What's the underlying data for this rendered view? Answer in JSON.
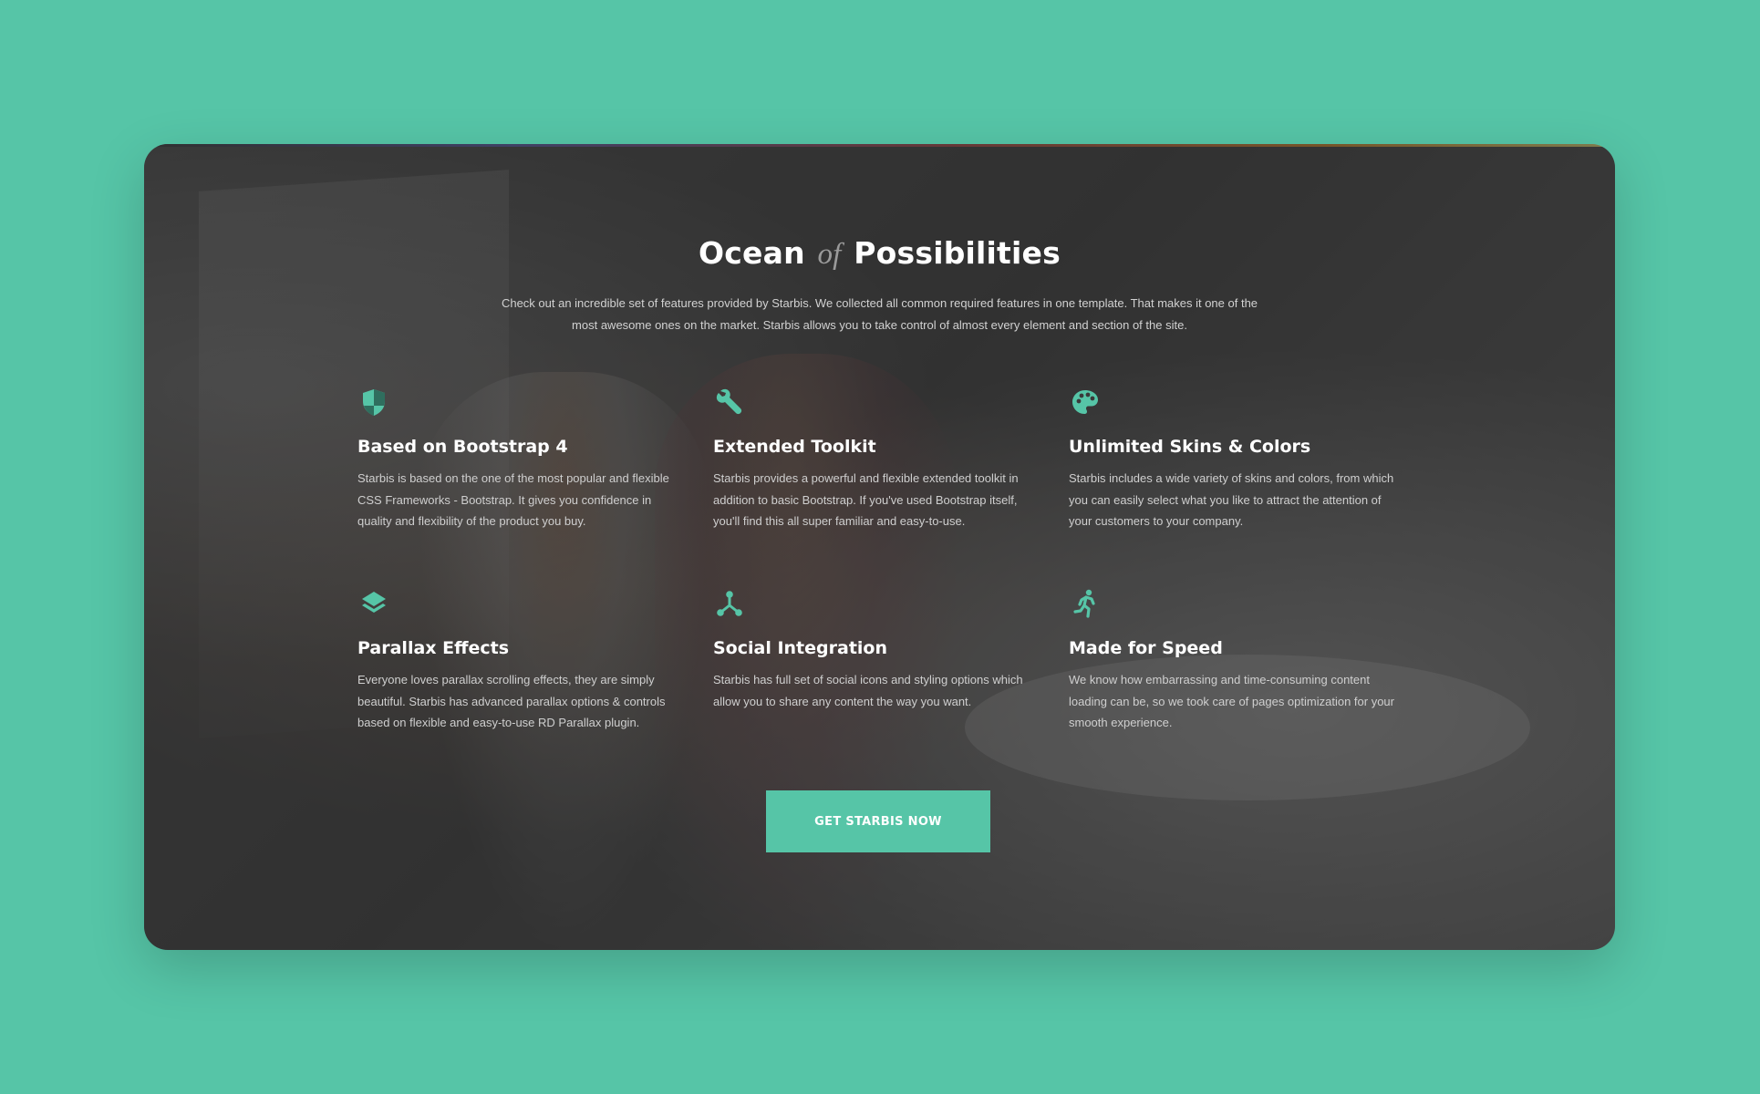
{
  "colors": {
    "page_background": "#56c5a7",
    "accent": "#56c5a7",
    "title_text": "#ffffff",
    "title_of_text": "#9a9a9a",
    "body_text": "#cfcfcf"
  },
  "section": {
    "title_part1": "Ocean",
    "title_of": "of",
    "title_part2": "Possibilities",
    "intro": "Check out an incredible set of features provided by Starbis. We collected all common required features in one template. That makes it one of the most awesome ones on the market. Starbis allows you to take control of almost every element and section of the site."
  },
  "features": [
    {
      "icon": "shield-icon",
      "title": "Based on Bootstrap 4",
      "text": "Starbis is based on the one of the most popular and flexible CSS Frameworks - Bootstrap. It gives you confidence in quality and flexibility of the product you buy."
    },
    {
      "icon": "wrench-icon",
      "title": "Extended Toolkit",
      "text": "Starbis provides a powerful and flexible extended toolkit in addition to basic Bootstrap. If you've used Bootstrap itself, you'll find this all super familiar and easy-to-use."
    },
    {
      "icon": "palette-icon",
      "title": "Unlimited Skins & Colors",
      "text": "Starbis includes a wide variety of skins and colors, from which you can easily select what you like to attract the attention of your customers to your company."
    },
    {
      "icon": "layers-icon",
      "title": "Parallax Effects",
      "text": "Everyone loves parallax scrolling effects, they are simply beautiful. Starbis has advanced parallax options & controls based on flexible and easy-to-use RD Parallax plugin."
    },
    {
      "icon": "share-nodes-icon",
      "title": "Social Integration",
      "text": "Starbis has full set of social icons and styling options which allow you to share any content the way you want."
    },
    {
      "icon": "running-icon",
      "title": "Made for Speed",
      "text": "We know how embarrassing and time-consuming content loading can be, so we took care of pages optimization for your smooth experience."
    }
  ],
  "cta": {
    "label": "GET STARBIS NOW"
  }
}
